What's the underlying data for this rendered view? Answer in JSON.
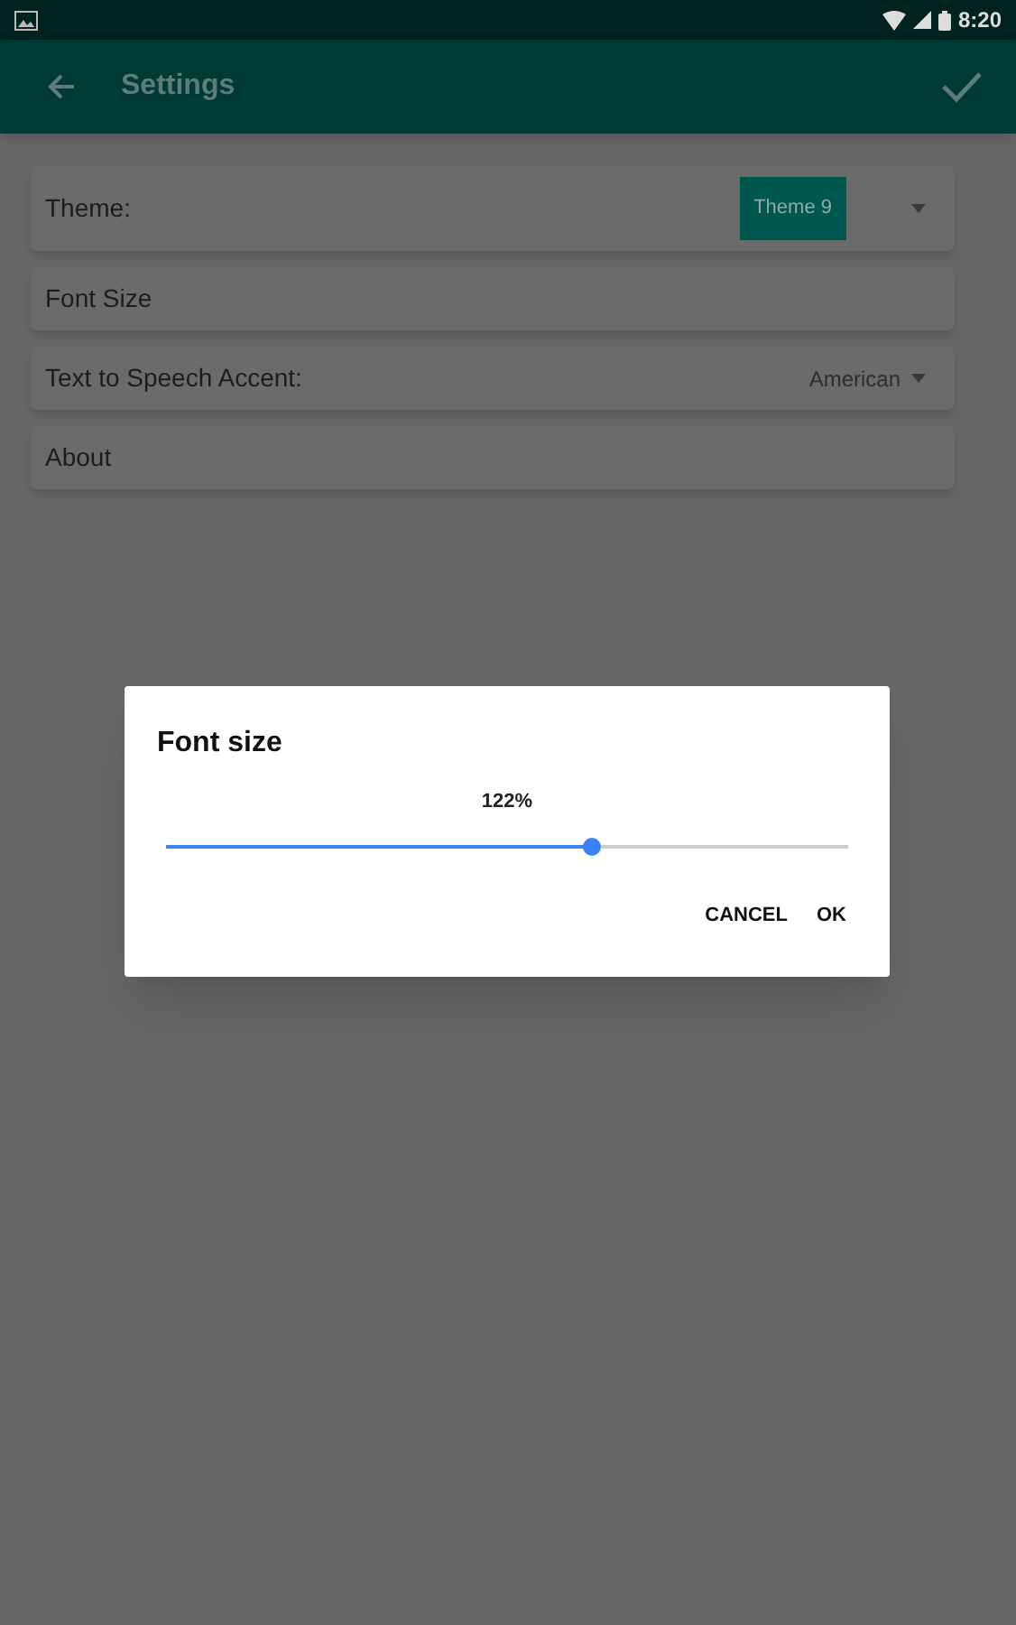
{
  "status_bar": {
    "time": "8:20"
  },
  "app_bar": {
    "title": "Settings"
  },
  "settings": [
    {
      "kind": "badge-dropdown",
      "label": "Theme:",
      "value": "Theme 9"
    },
    {
      "kind": "plain",
      "label": "Font Size"
    },
    {
      "kind": "dropdown",
      "label": "Text to Speech Accent:",
      "value": "American"
    },
    {
      "kind": "plain",
      "label": "About"
    }
  ],
  "dialog": {
    "title": "Font size",
    "reading": "122%",
    "level": 0.625,
    "buttons": [
      "CANCEL",
      "OK"
    ]
  }
}
